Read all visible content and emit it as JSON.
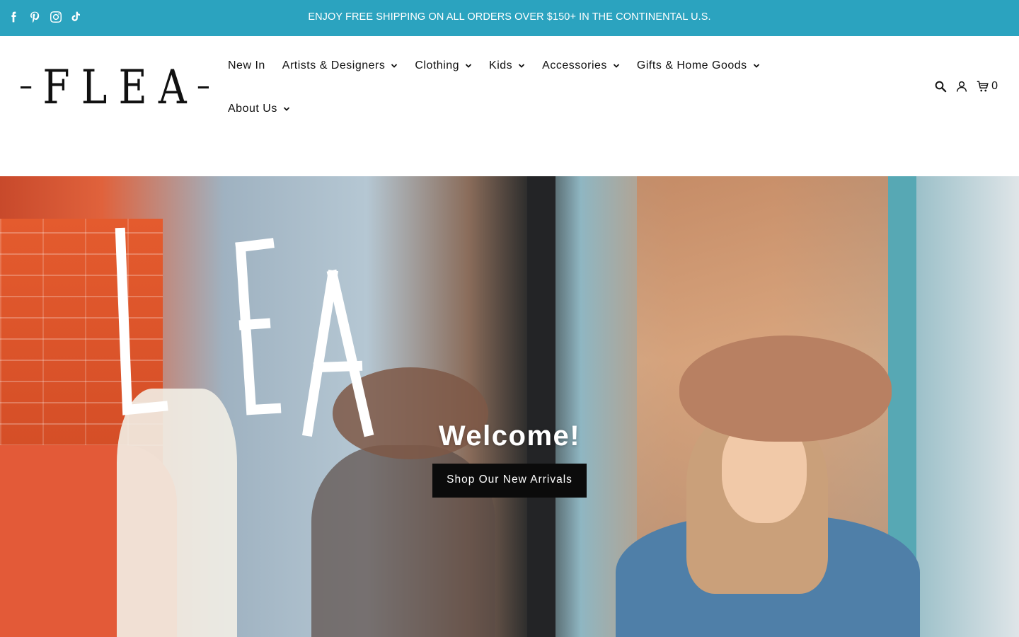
{
  "announcement": {
    "text": "ENJOY FREE SHIPPING ON ALL ORDERS OVER $150+ IN THE CONTINENTAL U.S.",
    "social_icons": [
      "facebook-icon",
      "pinterest-icon",
      "instagram-icon",
      "tiktok-icon"
    ]
  },
  "header": {
    "logo_letters": [
      "F",
      "L",
      "E",
      "A"
    ],
    "nav": [
      {
        "label": "New In",
        "has_dropdown": false
      },
      {
        "label": "Artists & Designers",
        "has_dropdown": true
      },
      {
        "label": "Clothing",
        "has_dropdown": true
      },
      {
        "label": "Kids",
        "has_dropdown": true
      },
      {
        "label": "Accessories",
        "has_dropdown": true
      },
      {
        "label": "Gifts & Home Goods",
        "has_dropdown": true
      },
      {
        "label": "About Us",
        "has_dropdown": true
      }
    ],
    "icons": [
      "search-icon",
      "account-icon",
      "cart-icon"
    ],
    "cart_count": "0"
  },
  "hero": {
    "title": "Welcome!",
    "button_label": "Shop Our New Arrivals"
  },
  "colors": {
    "announcement_bg": "#2ba3bf",
    "button_bg": "#0b0b0b"
  }
}
